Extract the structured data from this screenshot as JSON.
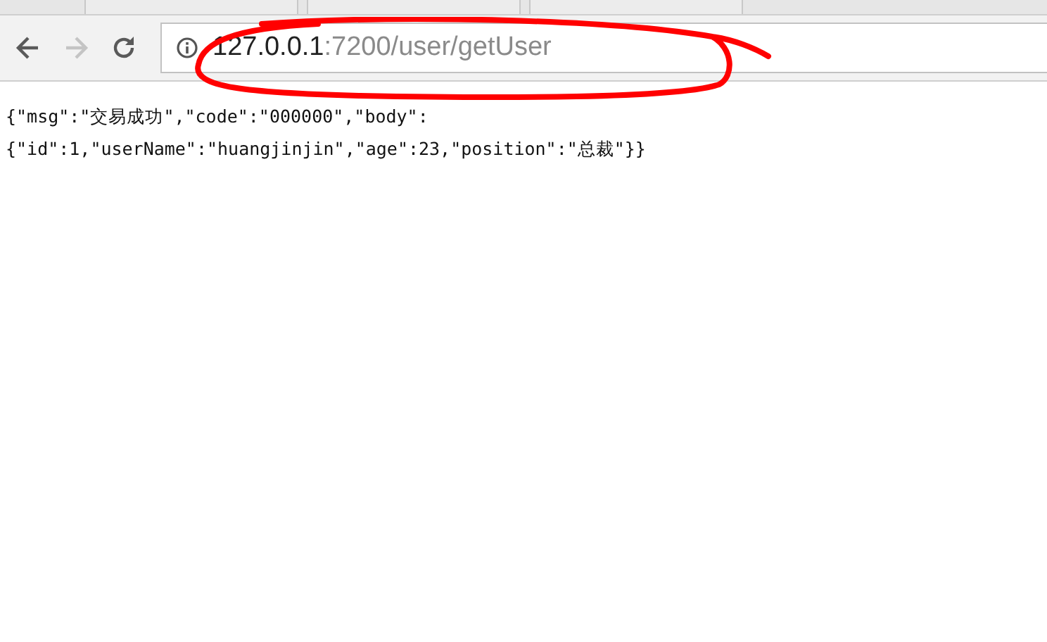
{
  "toolbar": {
    "address": {
      "host": "127.0.0.1",
      "path": ":7200/user/getUser"
    }
  },
  "content": {
    "lines": [
      "{\"msg\":\"交易成功\",\"code\":\"000000\",\"body\":",
      "{\"id\":1,\"userName\":\"huangjinjin\",\"age\":23,\"position\":\"总裁\"}}"
    ]
  },
  "annotation": {
    "kind": "ellipse",
    "color": "#ff0000"
  }
}
